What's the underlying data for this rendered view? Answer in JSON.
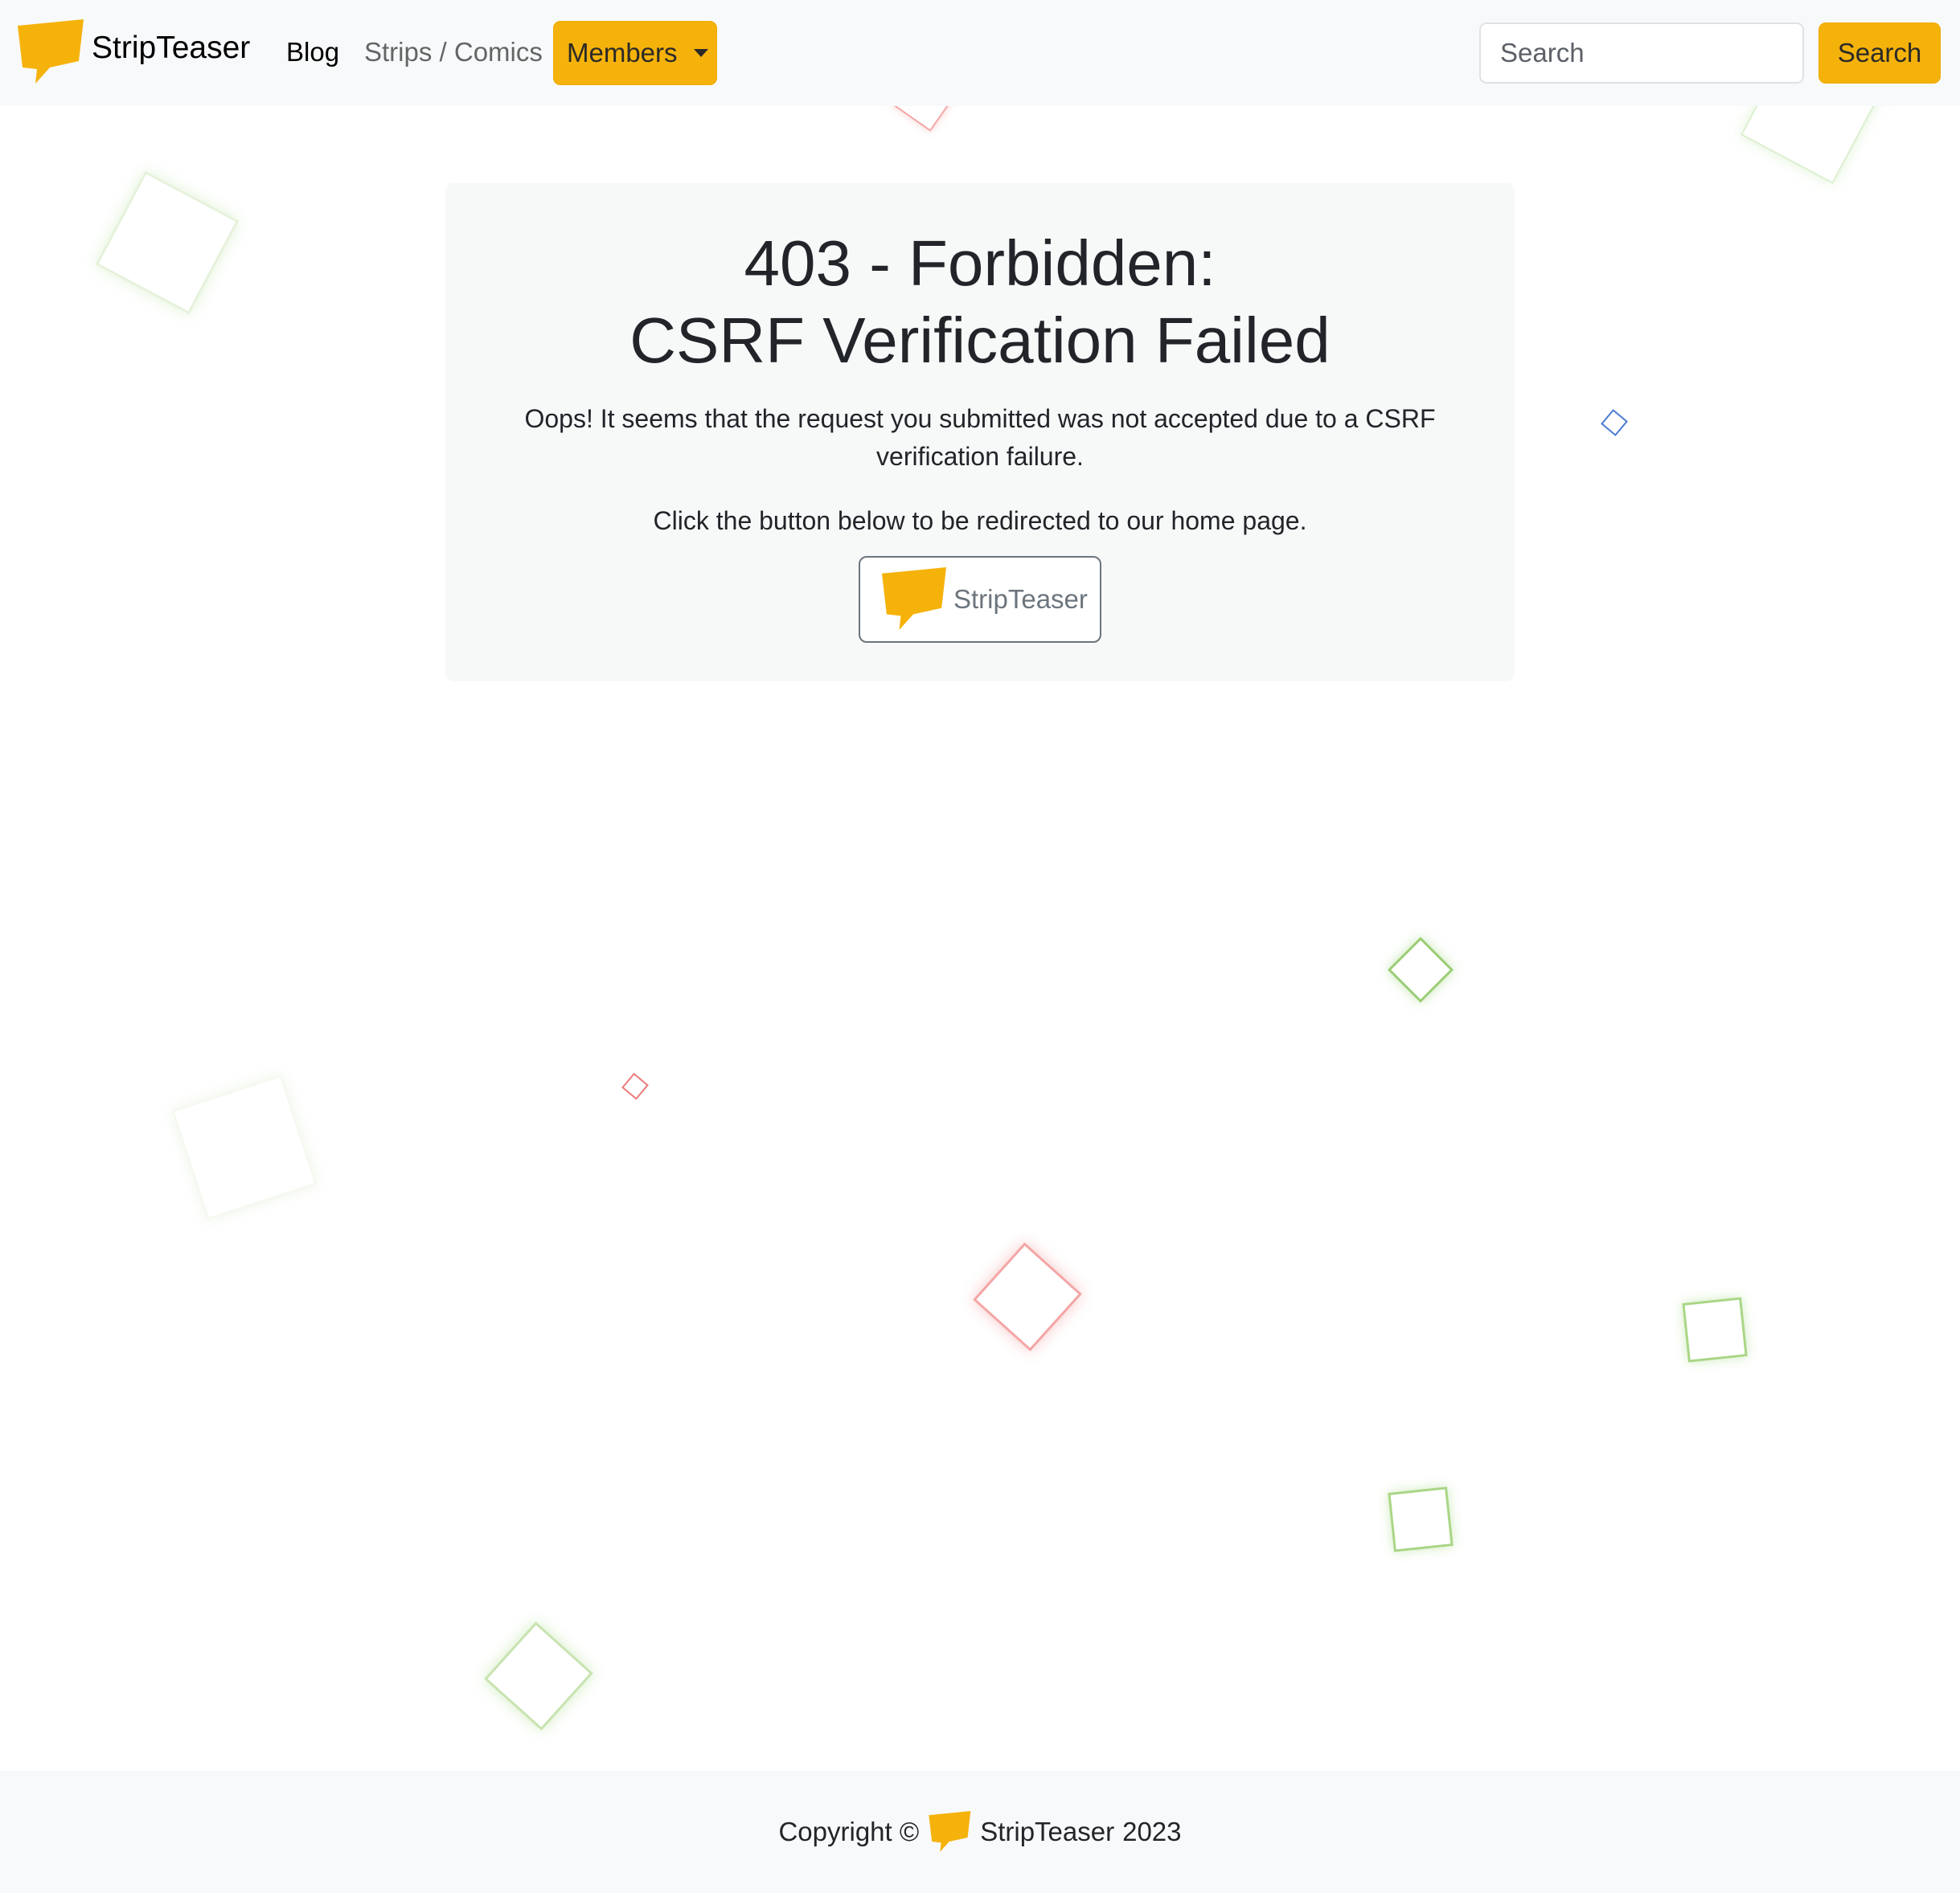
{
  "navbar": {
    "brand_name": "StripTeaser",
    "links": [
      {
        "label": "Blog"
      },
      {
        "label": "Strips / Comics"
      }
    ],
    "members_label": "Members",
    "search_placeholder": "Search",
    "search_button_label": "Search"
  },
  "error": {
    "title_line1": "403 - Forbidden:",
    "title_line2": "CSRF Verification Failed",
    "message": "Oops! It seems that the request you submitted was not accepted due to a CSRF verification failure.",
    "instruction": "Click the button below to be redirected to our home page.",
    "home_button_label": "StripTeaser"
  },
  "footer": {
    "copyright_prefix": "Copyright ©",
    "brand_name": "StripTeaser",
    "year": "2023"
  },
  "colors": {
    "accent": "#f5b20a",
    "navbar_bg": "#f8f9fa",
    "decor_green": "#9acd75",
    "decor_red": "#f08a8a",
    "decor_blue": "#4a7bd0"
  },
  "icons": {
    "brand": "speech-bubble-logo-icon",
    "dropdown": "caret-down-icon"
  }
}
